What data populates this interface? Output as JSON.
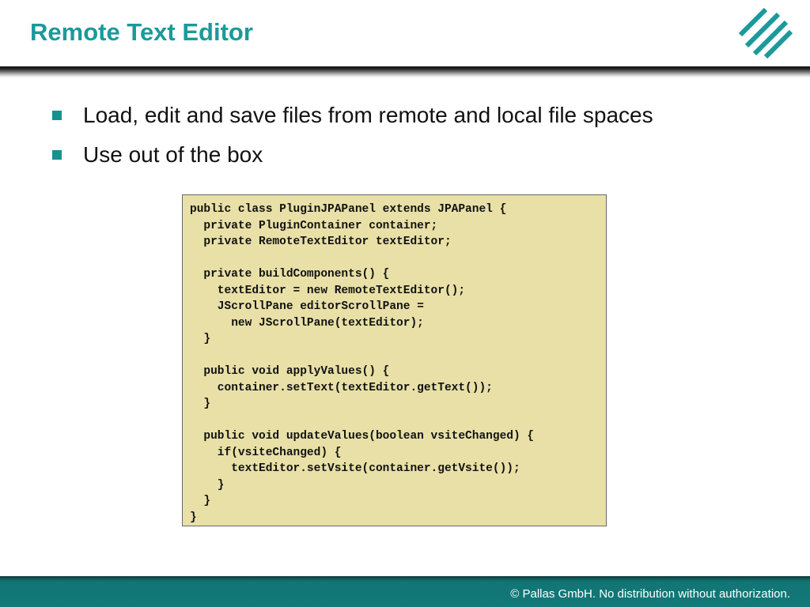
{
  "slide": {
    "title": "Remote Text Editor",
    "bullets": [
      "Load, edit and save files from remote and local file spaces",
      "Use out of the box"
    ],
    "code": "public class PluginJPAPanel extends JPAPanel {\n  private PluginContainer container;\n  private RemoteTextEditor textEditor;\n\n  private buildComponents() {\n    textEditor = new RemoteTextEditor();\n    JScrollPane editorScrollPane =\n      new JScrollPane(textEditor);\n  }\n\n  public void applyValues() {\n    container.setText(textEditor.getText());\n  }\n\n  public void updateValues(boolean vsiteChanged) {\n    if(vsiteChanged) {\n      textEditor.setVsite(container.getVsite());\n    }\n  }\n}"
  },
  "footer": {
    "copyright": "© Pallas GmbH. No distribution without authorization."
  },
  "colors": {
    "title": "#1a9a9a",
    "accent": "#1a8f8f",
    "code_background": "#e8e0a7",
    "footer_background": "#127878"
  },
  "icons": {
    "logo": "pallas-diagonal-stripes-logo",
    "bullet": "teal-square-bullet"
  }
}
